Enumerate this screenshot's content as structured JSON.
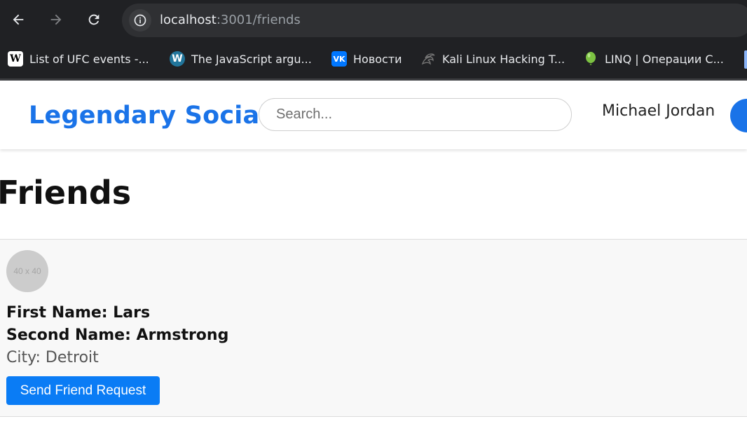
{
  "browser": {
    "url_host": "localhost",
    "url_path": ":3001/friends",
    "bookmarks": [
      {
        "label": "List of UFC events -...",
        "icon": "wikipedia-icon"
      },
      {
        "label": "The JavaScript argu...",
        "icon": "wordpress-icon"
      },
      {
        "label": "Новости",
        "icon": "vk-icon"
      },
      {
        "label": "Kali Linux Hacking T...",
        "icon": "kali-dragon-icon"
      },
      {
        "label": "LINQ | Операции С...",
        "icon": "balloon-icon"
      }
    ]
  },
  "header": {
    "brand": "Legendary Social",
    "search_placeholder": "Search...",
    "user_name": "Michael Jordan"
  },
  "page": {
    "title": "Friends"
  },
  "friends": [
    {
      "avatar_text": "40 x 40",
      "first_name": "First Name: Lars",
      "second_name": "Second Name: Armstrong",
      "city": "City: Detroit",
      "action_label": "Send Friend Request"
    }
  ],
  "colors": {
    "brand": "#1a73e8",
    "button": "#0a7cf5",
    "card_bg": "#f8f8f8",
    "chrome_bg": "#202124"
  }
}
